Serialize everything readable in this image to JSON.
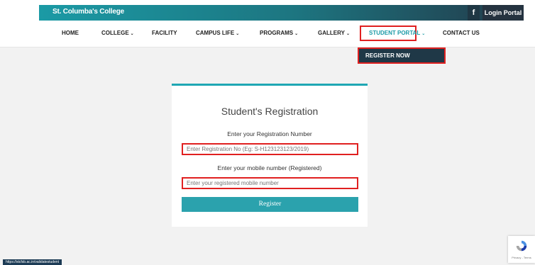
{
  "topbar": {
    "college_name": "St. Columba's College",
    "facebook_label": "f",
    "login_label": "Login Portal"
  },
  "nav": {
    "items": [
      {
        "label": "HOME",
        "chevron": false
      },
      {
        "label": "COLLEGE",
        "chevron": true
      },
      {
        "label": "FACILITY",
        "chevron": false
      },
      {
        "label": "CAMPUS LIFE",
        "chevron": true
      },
      {
        "label": "PROGRAMS",
        "chevron": true
      },
      {
        "label": "GALLERY",
        "chevron": true
      },
      {
        "label": "STUDENT PORTAL",
        "chevron": true
      },
      {
        "label": "CONTACT US",
        "chevron": false
      }
    ],
    "chevron_glyph": "⌄"
  },
  "dropdown": {
    "register_now": "REGISTER NOW"
  },
  "form": {
    "title": "Student's Registration",
    "reg_label": "Enter your Registration Number",
    "reg_placeholder": "Enter Registration No (Eg: S-H123123123/2019)",
    "mobile_label": "Enter your mobile number (Registered)",
    "mobile_placeholder": "Enter your registered mobile number",
    "submit_label": "Register"
  },
  "status": {
    "url": "https://stcfsb.ac.in/validatestudent"
  },
  "recaptcha": {
    "text": "Privacy - Terms"
  },
  "colors": {
    "accent": "#1fa7b4",
    "highlight": "#e02020",
    "dark": "#1f3847"
  }
}
